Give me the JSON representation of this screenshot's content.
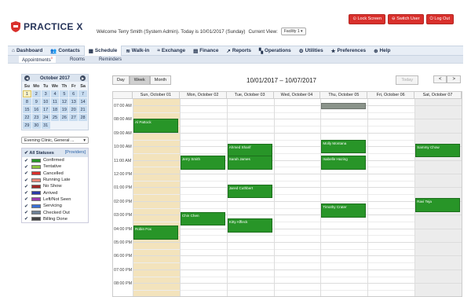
{
  "app": {
    "brand": "PRACTICE X",
    "brand_color": "#27355a"
  },
  "header": {
    "welcome": "Welcome Terry Smith (System Admin). Today is 10/01/2017 (Sunday)",
    "current_view_label": "Current View:",
    "facility": "Facility 1",
    "buttons": [
      {
        "label": "Lock Screen",
        "icon": "lock-icon"
      },
      {
        "label": "Switch User",
        "icon": "switch-user-icon"
      },
      {
        "label": "Log Out",
        "icon": "power-icon"
      }
    ]
  },
  "nav": [
    {
      "label": "Dashboard",
      "icon": "home-icon"
    },
    {
      "label": "Contacts",
      "icon": "people-icon"
    },
    {
      "label": "Schedule",
      "icon": "calendar-icon"
    },
    {
      "label": "Walk-in",
      "icon": "walk-in-icon"
    },
    {
      "label": "Exchange",
      "icon": "exchange-icon"
    },
    {
      "label": "Finance",
      "icon": "finance-icon"
    },
    {
      "label": "Reports",
      "icon": "chart-icon"
    },
    {
      "label": "Operations",
      "icon": "grid-icon"
    },
    {
      "label": "Utilities",
      "icon": "gear-icon"
    },
    {
      "label": "Preferences",
      "icon": "star-icon"
    },
    {
      "label": "Help",
      "icon": "help-icon"
    }
  ],
  "subnav": [
    {
      "label": "Appointments",
      "badge": "0"
    },
    {
      "label": "Rooms",
      "badge": ""
    },
    {
      "label": "Reminders",
      "badge": ""
    }
  ],
  "mini_calendar": {
    "month": "October 2017",
    "dows": [
      "Su",
      "Mo",
      "Tu",
      "We",
      "Th",
      "Fr",
      "Sa"
    ],
    "weeks": [
      [
        "1",
        "2",
        "3",
        "4",
        "5",
        "6",
        "7"
      ],
      [
        "8",
        "9",
        "10",
        "11",
        "12",
        "13",
        "14"
      ],
      [
        "15",
        "16",
        "17",
        "18",
        "19",
        "20",
        "21"
      ],
      [
        "22",
        "23",
        "24",
        "25",
        "26",
        "27",
        "28"
      ],
      [
        "29",
        "30",
        "31",
        "",
        "",
        "",
        ""
      ]
    ],
    "selected": "1"
  },
  "clinic_select": "Evening Clinic, General ...",
  "statuses": {
    "header": "All Statuses",
    "providers_link": "[Providers]",
    "items": [
      {
        "label": "Confirmed",
        "color": "#289528"
      },
      {
        "label": "Tentative",
        "color": "#8ac43f"
      },
      {
        "label": "Cancelled",
        "color": "#d9302c"
      },
      {
        "label": "Running Late",
        "color": "#e8877a"
      },
      {
        "label": "No Show",
        "color": "#a12626"
      },
      {
        "label": "Arrived",
        "color": "#2b3aa8"
      },
      {
        "label": "Left/Not Seen",
        "color": "#9b3bb0"
      },
      {
        "label": "Servicing",
        "color": "#3a6fd4"
      },
      {
        "label": "Checked Out",
        "color": "#6d7f94"
      },
      {
        "label": "Billing Done",
        "color": "#444444"
      }
    ]
  },
  "calendar": {
    "views": [
      "Day",
      "Week",
      "Month"
    ],
    "active_view": "Week",
    "range": "10/01/2017 – 10/07/2017",
    "today_label": "Today",
    "prev": "<",
    "next": ">",
    "days": [
      "Sun, October 01",
      "Mon, October 02",
      "Tue, October 03",
      "Wed, October 04",
      "Thu, October 05",
      "Fri, October 06",
      "Sat, October 07"
    ],
    "times": [
      "07:00 AM",
      "08:00 AM",
      "09:00 AM",
      "10:00 AM",
      "11:00 AM",
      "12:00 PM",
      "01:00 PM",
      "02:00 PM",
      "03:00 PM",
      "04:00 PM",
      "05:00 PM",
      "06:00 PM",
      "07:00 PM",
      "08:00 PM"
    ],
    "appointments": [
      {
        "name": "Al Pattock",
        "day": 0,
        "start": 8.0,
        "end": 9.0
      },
      {
        "name": "Robin Fox",
        "day": 0,
        "start": 15.8,
        "end": 16.8
      },
      {
        "name": "Jerry Smith",
        "day": 1,
        "start": 10.7,
        "end": 11.7
      },
      {
        "name": "Chin Chen",
        "day": 1,
        "start": 14.8,
        "end": 15.8
      },
      {
        "name": "Ahmed Sharif",
        "day": 2,
        "start": 9.8,
        "end": 10.8
      },
      {
        "name": "Sarah James",
        "day": 2,
        "start": 10.7,
        "end": 11.7
      },
      {
        "name": "Jared Cuthbert",
        "day": 2,
        "start": 12.8,
        "end": 13.8
      },
      {
        "name": "Kitty Affleck",
        "day": 2,
        "start": 15.3,
        "end": 16.3
      },
      {
        "name": "",
        "day": 4,
        "start": 6.8,
        "end": 7.3,
        "grey": true
      },
      {
        "name": "Molly Montana",
        "day": 4,
        "start": 9.5,
        "end": 10.5
      },
      {
        "name": "Isabelle Hazing",
        "day": 4,
        "start": 10.7,
        "end": 11.7
      },
      {
        "name": "Timothy Crater",
        "day": 4,
        "start": 14.2,
        "end": 15.2
      },
      {
        "name": "Sammy Chow",
        "day": 6,
        "start": 9.8,
        "end": 10.8
      },
      {
        "name": "Ravi Teja",
        "day": 6,
        "start": 13.8,
        "end": 14.8
      }
    ]
  }
}
